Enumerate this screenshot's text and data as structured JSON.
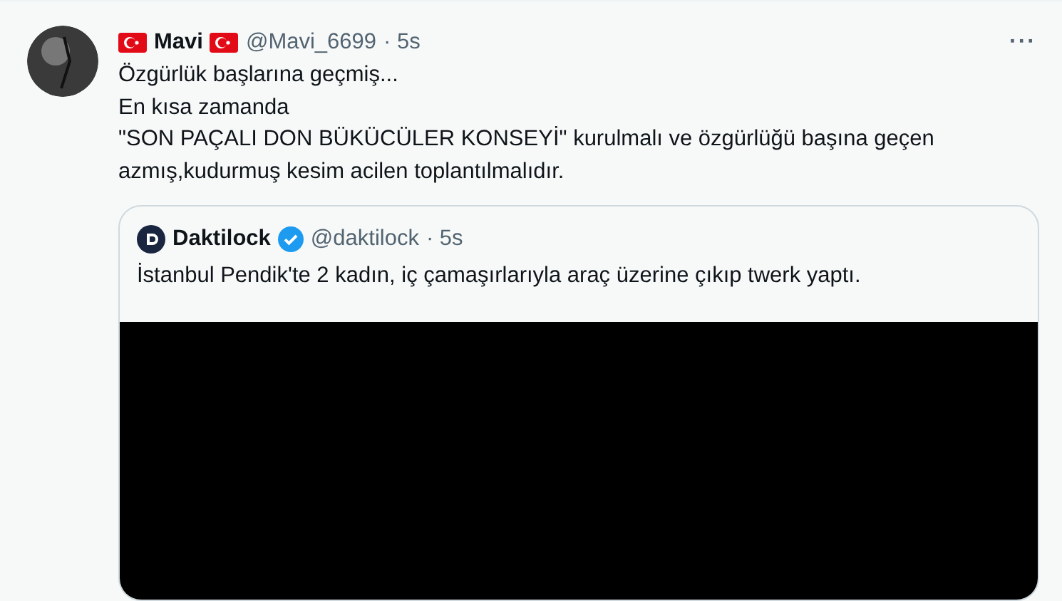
{
  "tweet": {
    "author": {
      "name": "Mavi",
      "handle": "@Mavi_6699",
      "time": "· 5s"
    },
    "more": "···",
    "lines": [
      "Özgürlük başlarına geçmiş...",
      "En kısa zamanda",
      "\"SON PAÇALI DON BÜKÜCÜLER KONSEYİ\" kurulmalı ve özgürlüğü başına geçen azmış,kudurmuş kesim acilen toplantılmalıdır."
    ],
    "quote": {
      "author": {
        "name": "Daktilock",
        "handle": "@daktilock",
        "time": "· 5s",
        "verified": true
      },
      "text": "İstanbul Pendik'te 2 kadın, iç çamaşırlarıyla araç üzerine çıkıp twerk yaptı.",
      "media": {
        "kind": "video"
      }
    }
  }
}
